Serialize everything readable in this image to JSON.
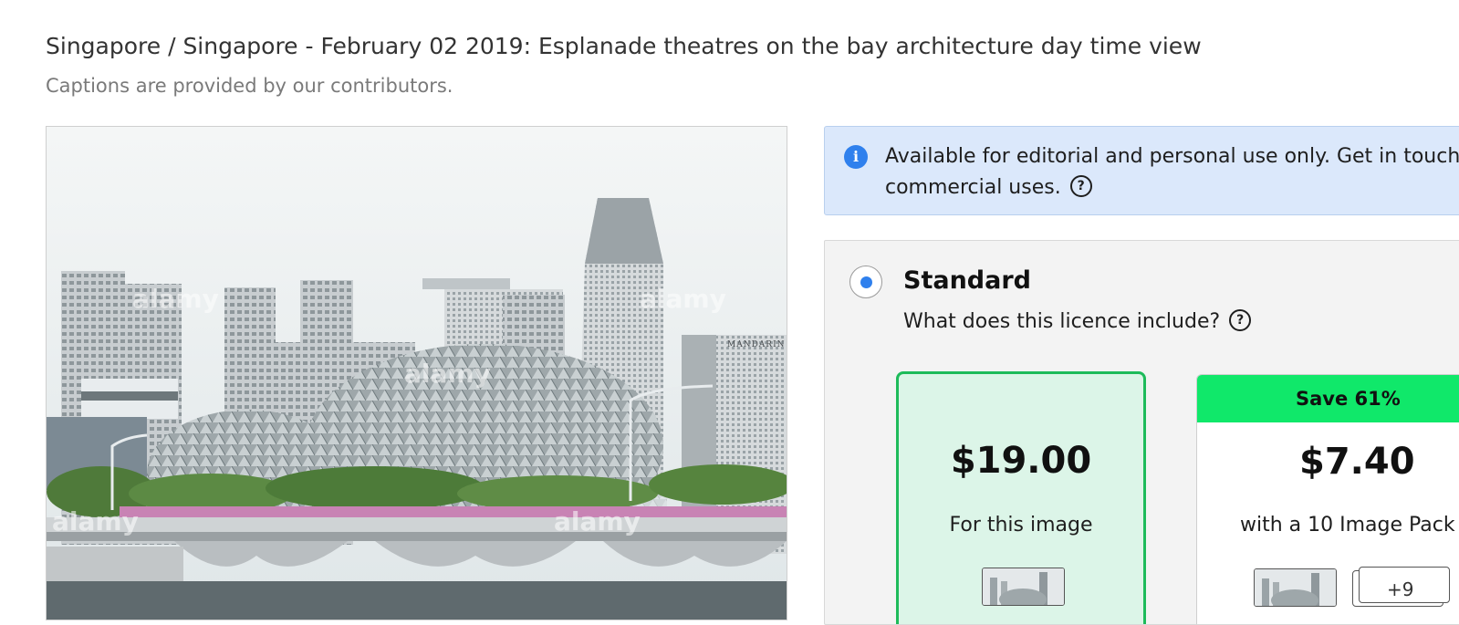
{
  "header": {
    "title": "Singapore / Singapore - February 02 2019: Esplanade theatres on the bay architecture day time view",
    "caption_note": "Captions are provided by our contributors."
  },
  "photo": {
    "watermark": "alamy",
    "tower_sign": "MANDARIN"
  },
  "notice": {
    "icon": "info-icon",
    "text": "Available for editorial and personal use only. Get in touch for commercial uses.",
    "help_icon": "question-circle-icon"
  },
  "licence": {
    "selected": true,
    "name": "Standard",
    "help_text": "What does this licence include?",
    "options": [
      {
        "price": "$19.00",
        "description": "For this image",
        "selected": true
      },
      {
        "badge": "Save 61%",
        "price": "$7.40",
        "description": "with a 10 Image Pack",
        "more_count": "+9"
      }
    ]
  },
  "colors": {
    "accent_blue": "#2f80ed",
    "selected_green": "#1dbb5a",
    "save_badge": "#10e86a",
    "notice_bg": "#dbe8fb"
  }
}
